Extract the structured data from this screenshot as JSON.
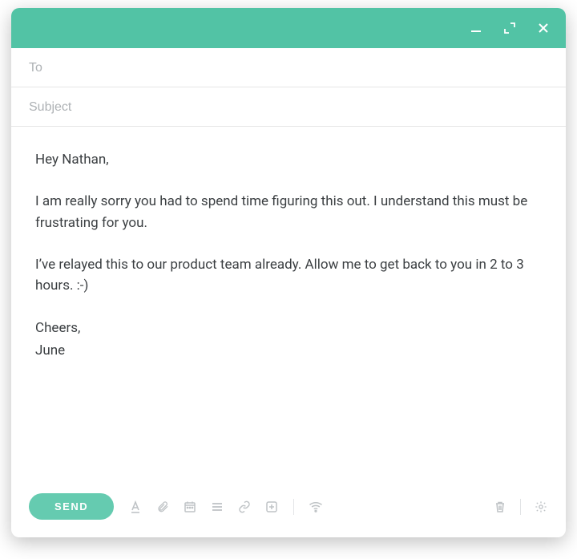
{
  "colors": {
    "accent": "#52c3a5",
    "send_button": "#65cbb0",
    "icon_muted": "#bfc3c6"
  },
  "window_controls": {
    "minimize": "minimize",
    "expand": "expand",
    "close": "close"
  },
  "fields": {
    "to_placeholder": "To",
    "to_value": "",
    "subject_placeholder": "Subject",
    "subject_value": ""
  },
  "body": {
    "greeting": "Hey Nathan,",
    "para1": "I am really sorry you had to spend time figuring this out. I understand this must be frustrating for you.",
    "para2": "I’ve relayed this to our product team already. Allow me to get back to you in 2 to 3 hours. :-)",
    "signoff": "Cheers,",
    "name": "June"
  },
  "toolbar": {
    "send_label": "SEND",
    "icons": {
      "text_format": "text-format-icon",
      "attach": "attach-icon",
      "calendar": "calendar-icon",
      "list": "list-icon",
      "link": "link-icon",
      "insert": "insert-icon",
      "wifi": "wifi-icon",
      "trash": "trash-icon",
      "settings": "settings-icon"
    }
  }
}
